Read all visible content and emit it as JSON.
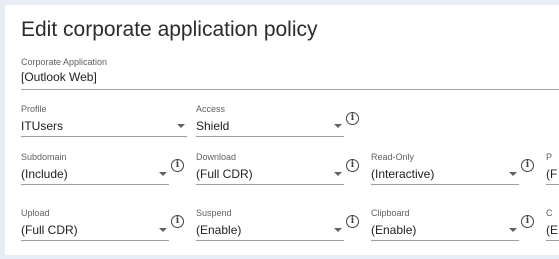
{
  "title": "Edit corporate application policy",
  "corporate_application": {
    "label": "Corporate Application",
    "value": "[Outlook Web]"
  },
  "row1": [
    {
      "label": "Profile",
      "value": "ITUsers",
      "info": false
    },
    {
      "label": "Access",
      "value": "Shield",
      "info": true
    }
  ],
  "row2": [
    {
      "label": "Subdomain",
      "value": "(Include)"
    },
    {
      "label": "Download",
      "value": "(Full CDR)"
    },
    {
      "label": "Read-Only",
      "value": "(Interactive)"
    },
    {
      "label": "P",
      "value": "(F"
    }
  ],
  "row3": [
    {
      "label": "Upload",
      "value": "(Full CDR)"
    },
    {
      "label": "Suspend",
      "value": "(Enable)"
    },
    {
      "label": "Clipboard",
      "value": "(Enable)"
    },
    {
      "label": "C",
      "value": "(E"
    }
  ],
  "icons": {
    "info": "info-icon",
    "dropdown": "chevron-down-icon"
  },
  "colors": {
    "background": "#e8edf5",
    "card": "#ffffff",
    "underline": "#9e9e9e"
  }
}
